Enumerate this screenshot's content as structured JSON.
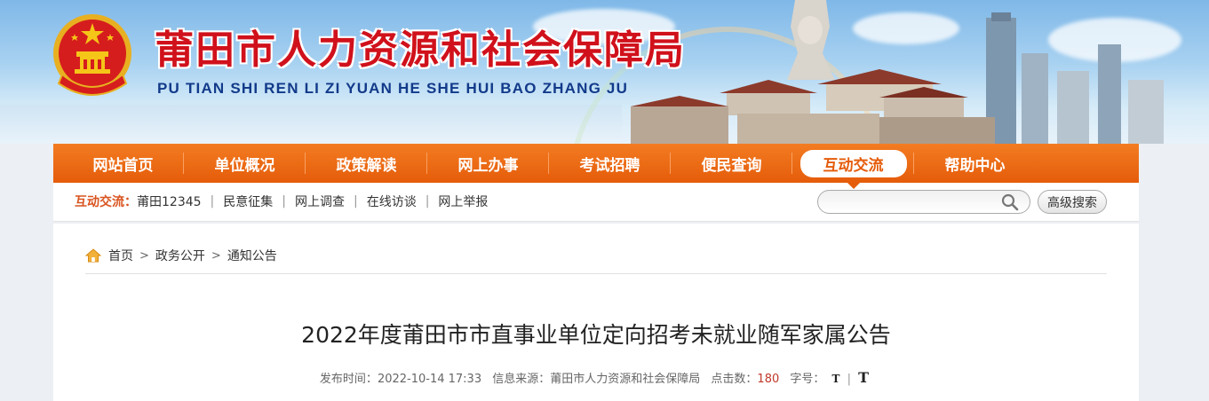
{
  "header": {
    "title": "莆田市人力资源和社会保障局",
    "pinyin": "PU TIAN SHI REN LI ZI YUAN HE SHE HUI BAO ZHANG JU",
    "emblem_icon": "national-emblem-icon"
  },
  "nav": {
    "items": [
      {
        "label": "网站首页"
      },
      {
        "label": "单位概况"
      },
      {
        "label": "政策解读"
      },
      {
        "label": "网上办事"
      },
      {
        "label": "考试招聘"
      },
      {
        "label": "便民查询"
      },
      {
        "label": "互动交流",
        "active": true
      },
      {
        "label": "帮助中心"
      }
    ]
  },
  "subnav": {
    "label": "互动交流：",
    "links": [
      "莆田12345",
      "民意征集",
      "网上调查",
      "在线访谈",
      "网上举报"
    ],
    "search_placeholder": "",
    "search_value": "",
    "advanced_search_label": "高级搜索"
  },
  "breadcrumb": {
    "items": [
      "首页",
      "政务公开",
      "通知公告"
    ]
  },
  "article": {
    "title": "2022年度莆田市市直事业单位定向招考未就业随军家属公告",
    "meta": {
      "publish_label": "发布时间：",
      "publish_time": "2022-10-14 17:33",
      "source_label": "信息来源：",
      "source": "莆田市人力资源和社会保障局",
      "clicks_label": "点击数：",
      "clicks": "180",
      "font_label": "字号：",
      "font_small": "T",
      "font_large": "T"
    }
  },
  "colors": {
    "brand_red": "#d0111b",
    "nav_orange": "#e55c0a",
    "pinyin_blue": "#123a8a"
  }
}
